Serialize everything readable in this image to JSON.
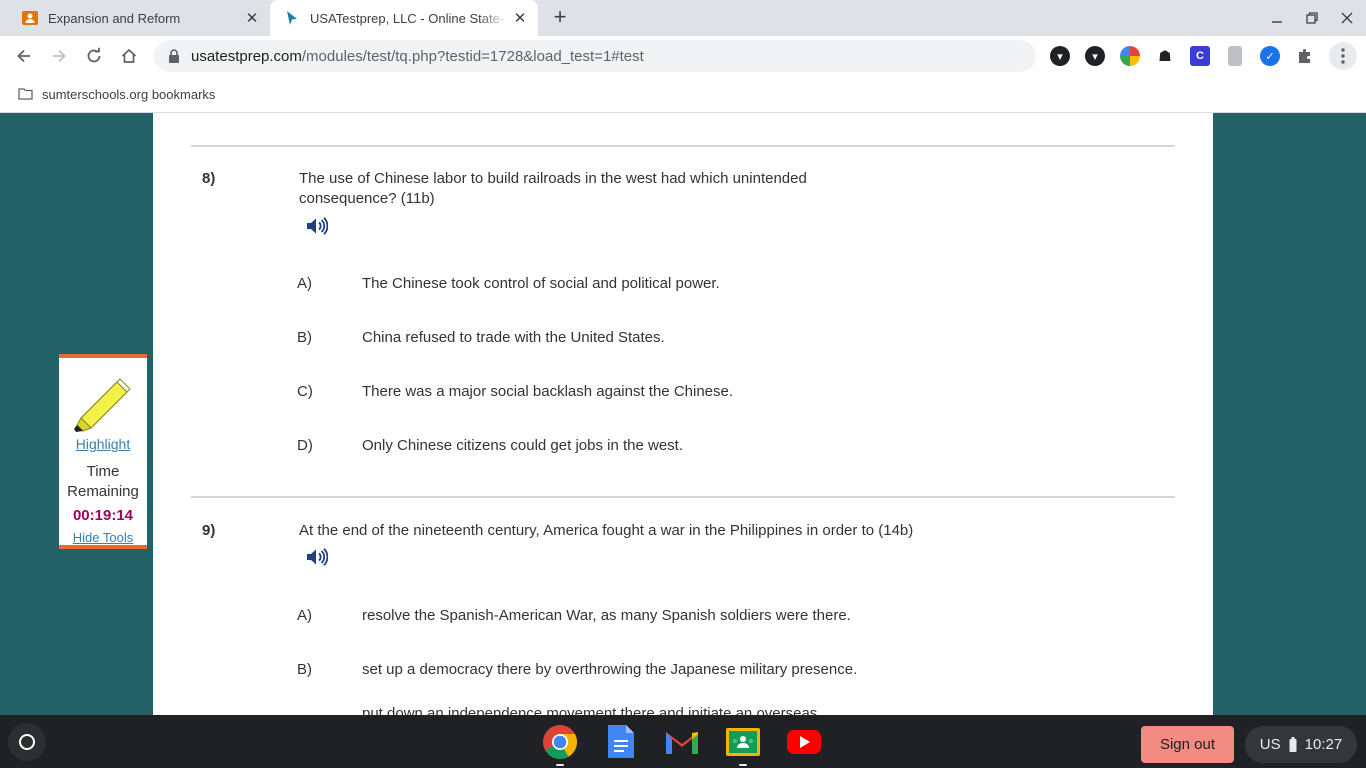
{
  "browser": {
    "tabs": [
      {
        "title": "Expansion and Reform",
        "active": false,
        "favicon": "classroom-assignment-icon"
      },
      {
        "title": "USATestprep, LLC - Online State-",
        "active": true,
        "favicon": "usatestprep-icon"
      }
    ],
    "url_host": "usatestprep.com",
    "url_path": "/modules/test/tq.php?testid=1728&load_test=1#test",
    "bookmark_folder": "sumterschools.org bookmarks"
  },
  "tools": {
    "highlight_label": "Highlight",
    "time_label": "Time Remaining",
    "time_value": "00:19:14",
    "hide_label": "Hide Tools"
  },
  "questions": [
    {
      "number": "8)",
      "text_line1": "The use of Chinese labor to build railroads in the west had which unintended",
      "text_line2": "consequence? (11b)",
      "answers": [
        {
          "letter": "A)",
          "text": "The Chinese took control of social and political power."
        },
        {
          "letter": "B)",
          "text": "China refused to trade with the United States."
        },
        {
          "letter": "C)",
          "text": "There was a major social backlash against the Chinese."
        },
        {
          "letter": "D)",
          "text": "Only Chinese citizens could get jobs in the west."
        }
      ]
    },
    {
      "number": "9)",
      "text_line1": "At the end of the nineteenth century, America fought a war in the Philippines in order to (14b)",
      "answers": [
        {
          "letter": "A)",
          "text": "resolve the Spanish-American War, as many Spanish soldiers were there."
        },
        {
          "letter": "B)",
          "text": "set up a democracy there by overthrowing the Japanese military presence."
        },
        {
          "letter": "",
          "text": "put down an independence movement there and initiate an overseas"
        }
      ]
    }
  ],
  "shelf": {
    "apps": [
      "chrome-icon",
      "google-docs-icon",
      "gmail-icon",
      "google-classroom-icon",
      "youtube-icon"
    ],
    "sign_out": "Sign out",
    "input_method": "US",
    "clock": "10:27"
  },
  "colors": {
    "page_background": "#24626a",
    "tools_border": "#ee6a2c",
    "timer": "#a00060",
    "link": "#3a7fb0",
    "sign_out_button": "#f28b82"
  }
}
